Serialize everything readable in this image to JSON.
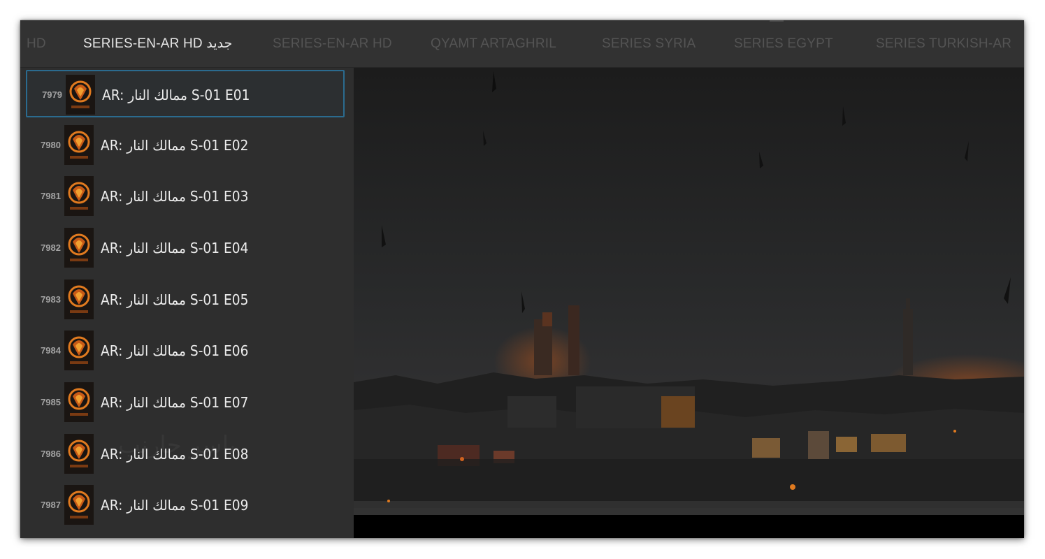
{
  "tabs": [
    {
      "label": "HD"
    },
    {
      "label": "SERIES-EN-AR HD جديد"
    },
    {
      "label": "SERIES-EN-AR HD"
    },
    {
      "label": "QYAMT ARTAGHRIL"
    },
    {
      "label": "SERIES SYRIA"
    },
    {
      "label": "SERIES  EGYPT"
    },
    {
      "label": "SERIES TURKISH-AR"
    }
  ],
  "active_tab": "SERIES-EN-AR HD جديد",
  "episodes": [
    {
      "number": "7979",
      "title": "AR: ممالك النار S-01 E01"
    },
    {
      "number": "7980",
      "title": "AR: ممالك النار S-01 E02"
    },
    {
      "number": "7981",
      "title": "AR: ممالك النار S-01 E03"
    },
    {
      "number": "7982",
      "title": "AR: ممالك النار S-01 E04"
    },
    {
      "number": "7983",
      "title": "AR: ممالك النار S-01 E05"
    },
    {
      "number": "7984",
      "title": "AR: ممالك النار S-01 E06"
    },
    {
      "number": "7985",
      "title": "AR: ممالك النار S-01 E07"
    },
    {
      "number": "7986",
      "title": "AR: ممالك النار S-01 E08"
    },
    {
      "number": "7987",
      "title": "AR: ممالك النار S-01 E09"
    }
  ],
  "selected_episode": "7979",
  "thumbnail_icon": "series-poster-icon",
  "colors": {
    "accent_border": "#2b6b8f",
    "sidebar_bg": "#2e2e2e",
    "topbar_bg": "#323232",
    "text_primary": "#ececec",
    "text_inactive": "#545454",
    "fire": "#e07a1f"
  }
}
